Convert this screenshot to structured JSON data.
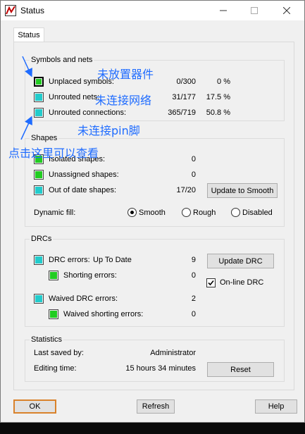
{
  "window": {
    "title": "Status"
  },
  "tabs": [
    {
      "label": "Status"
    }
  ],
  "symbols_nets": {
    "title": "Symbols and nets",
    "rows": [
      {
        "label": "Unplaced symbols:",
        "value": "0/300",
        "percent": "0 %",
        "color": "#22cc22",
        "border": "#000000"
      },
      {
        "label": "Unrouted nets:",
        "value": "31/177",
        "percent": "17.5 %",
        "color": "#22cccc",
        "border": "#444444"
      },
      {
        "label": "Unrouted connections:",
        "value": "365/719",
        "percent": "50.8 %",
        "color": "#22cccc",
        "border": "#444444"
      }
    ]
  },
  "shapes": {
    "title": "Shapes",
    "rows": [
      {
        "label": "Isolated shapes:",
        "value": "0",
        "color": "#22cc22"
      },
      {
        "label": "Unassigned shapes:",
        "value": "0",
        "color": "#22cc22"
      },
      {
        "label": "Out of date shapes:",
        "value": "17/20",
        "color": "#22cccc"
      }
    ],
    "update_button": "Update to Smooth",
    "dynamic_fill_label": "Dynamic fill:",
    "fill_options": [
      "Smooth",
      "Rough",
      "Disabled"
    ],
    "fill_selected": "Smooth"
  },
  "drcs": {
    "title": "DRCs",
    "drc_errors_label": "DRC errors:",
    "drc_status": "Up To Date",
    "drc_errors_value": "9",
    "shorting_label": "Shorting errors:",
    "shorting_value": "0",
    "waived_label": "Waived DRC errors:",
    "waived_value": "2",
    "waived_shorting_label": "Waived shorting errors:",
    "waived_shorting_value": "0",
    "update_button": "Update DRC",
    "online_drc_label": "On-line DRC",
    "online_drc_checked": true,
    "colors": {
      "cyan": "#22cccc",
      "green": "#22cc22"
    }
  },
  "statistics": {
    "title": "Statistics",
    "last_saved_label": "Last saved by:",
    "last_saved_value": "Administrator",
    "editing_time_label": "Editing time:",
    "editing_time_value": "15 hours 34 minutes",
    "reset_button": "Reset"
  },
  "footer": {
    "ok": "OK",
    "refresh": "Refresh",
    "help": "Help"
  },
  "annotations": {
    "unplaced": "未放置器件",
    "unrouted_nets": "未连接网络",
    "unrouted_pins": "未连接pin脚",
    "click_here": "点击这里可以查看",
    "color": "#1f6cff"
  }
}
